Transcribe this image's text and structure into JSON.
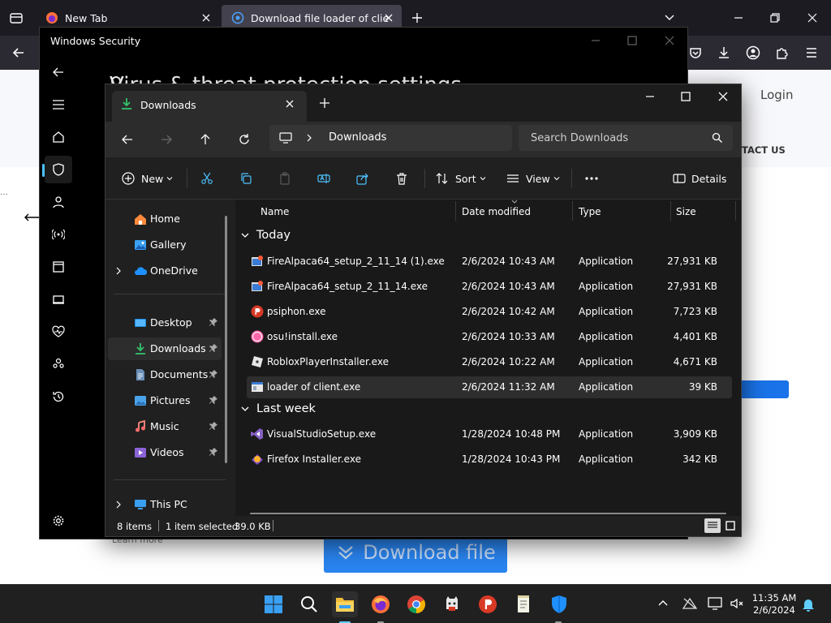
{
  "browser": {
    "tabs": [
      {
        "title": "New Tab"
      },
      {
        "title": "Download file loader of client.e"
      }
    ],
    "page": {
      "login": "Login",
      "contact": "TACT US",
      "download_button": "Download file",
      "learn_more": "Learn more"
    }
  },
  "windows_security": {
    "title": "Windows Security",
    "heading": "Virus & threat protection settings"
  },
  "explorer": {
    "tab_title": "Downloads",
    "breadcrumb": "Downloads",
    "search_placeholder": "Search Downloads",
    "commands": {
      "new": "New",
      "sort": "Sort",
      "view": "View",
      "details": "Details"
    },
    "sidebar": [
      {
        "label": "Home",
        "icon": "home-icon"
      },
      {
        "label": "Gallery",
        "icon": "gallery-icon"
      },
      {
        "label": "OneDrive",
        "icon": "onedrive-icon"
      },
      {
        "label": "Desktop",
        "icon": "desktop-folder-icon",
        "pinned": true
      },
      {
        "label": "Downloads",
        "icon": "downloads-folder-icon",
        "pinned": true,
        "selected": true
      },
      {
        "label": "Documents",
        "icon": "documents-folder-icon",
        "pinned": true
      },
      {
        "label": "Pictures",
        "icon": "pictures-folder-icon",
        "pinned": true
      },
      {
        "label": "Music",
        "icon": "music-folder-icon",
        "pinned": true
      },
      {
        "label": "Videos",
        "icon": "videos-folder-icon",
        "pinned": true
      },
      {
        "label": "This PC",
        "icon": "this-pc-icon"
      }
    ],
    "columns": {
      "name": "Name",
      "date": "Date modified",
      "type": "Type",
      "size": "Size"
    },
    "groups": [
      {
        "label": "Today",
        "files": [
          {
            "name": "FireAlpaca64_setup_2_11_14 (1).exe",
            "date": "2/6/2024 10:43 AM",
            "type": "Application",
            "size": "27,931 KB",
            "icon": "firealpaca-icon"
          },
          {
            "name": "FireAlpaca64_setup_2_11_14.exe",
            "date": "2/6/2024 10:43 AM",
            "type": "Application",
            "size": "27,931 KB",
            "icon": "firealpaca-icon"
          },
          {
            "name": "psiphon.exe",
            "date": "2/6/2024 10:42 AM",
            "type": "Application",
            "size": "7,723 KB",
            "icon": "psiphon-icon"
          },
          {
            "name": "osu!install.exe",
            "date": "2/6/2024 10:33 AM",
            "type": "Application",
            "size": "4,401 KB",
            "icon": "osu-icon"
          },
          {
            "name": "RobloxPlayerInstaller.exe",
            "date": "2/6/2024 10:22 AM",
            "type": "Application",
            "size": "4,671 KB",
            "icon": "roblox-icon"
          },
          {
            "name": "loader of client.exe",
            "date": "2/6/2024 11:32 AM",
            "type": "Application",
            "size": "39 KB",
            "icon": "exe-icon",
            "selected": true
          }
        ]
      },
      {
        "label": "Last week",
        "files": [
          {
            "name": "VisualStudioSetup.exe",
            "date": "1/28/2024 10:48 PM",
            "type": "Application",
            "size": "3,909 KB",
            "icon": "visual-studio-icon"
          },
          {
            "name": "Firefox Installer.exe",
            "date": "1/28/2024 10:43 PM",
            "type": "Application",
            "size": "342 KB",
            "icon": "firefox-installer-icon"
          }
        ]
      }
    ],
    "status": {
      "items": "8 items",
      "selected": "1 item selected",
      "size": "39.0 KB"
    }
  },
  "taskbar": {
    "time": "11:35 AM",
    "date": "2/6/2024"
  }
}
